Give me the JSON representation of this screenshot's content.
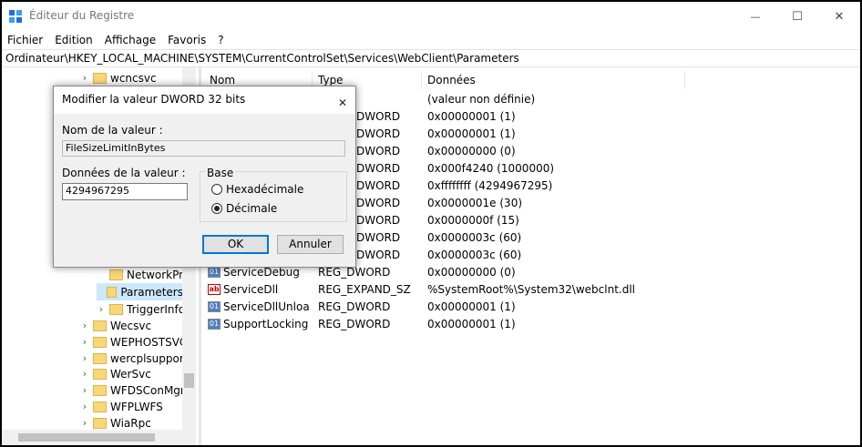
{
  "window": {
    "title": "Éditeur du Registre",
    "minimize_glyph": "—",
    "maximize_glyph": "☐",
    "close_glyph": "✕"
  },
  "menu": [
    "Fichier",
    "Edition",
    "Affichage",
    "Favoris",
    "?"
  ],
  "address": "Ordinateur\\HKEY_LOCAL_MACHINE\\SYSTEM\\CurrentControlSet\\Services\\WebClient\\Parameters",
  "tree": {
    "items": [
      {
        "label": "wcncsvc",
        "chevron": "›"
      },
      {
        "label": "NetworkPro",
        "chevron": ""
      },
      {
        "label": "Parameters",
        "chevron": "",
        "selected": true
      },
      {
        "label": "TriggerInfo",
        "chevron": "›"
      },
      {
        "label": "Wecsvc",
        "chevron": "›"
      },
      {
        "label": "WEPHOSTSVC",
        "chevron": "›"
      },
      {
        "label": "wercplsupport",
        "chevron": "›"
      },
      {
        "label": "WerSvc",
        "chevron": "›"
      },
      {
        "label": "WFDSConMgrS",
        "chevron": "›"
      },
      {
        "label": "WFPLWFS",
        "chevron": "›"
      },
      {
        "label": "WiaRpc",
        "chevron": "›"
      }
    ]
  },
  "list": {
    "headers": {
      "name": "Nom",
      "type": "Type",
      "data": "Données"
    },
    "rows": [
      {
        "name": "",
        "type": "",
        "data": "(valeur non définie)",
        "icon": "",
        "type_tail": ""
      },
      {
        "name": "",
        "type": "REG_DWORD",
        "type_tail": "DWORD",
        "data": "0x00000001 (1)",
        "icon": ""
      },
      {
        "name": "",
        "type": "REG_DWORD",
        "type_tail": "DWORD",
        "data": "0x00000001 (1)",
        "icon": ""
      },
      {
        "name": "",
        "type": "REG_DWORD",
        "type_tail": "DWORD",
        "data": "0x00000000 (0)",
        "icon": ""
      },
      {
        "name": "",
        "type": "REG_DWORD",
        "type_tail": "DWORD",
        "data": "0x000f4240 (1000000)",
        "icon": ""
      },
      {
        "name": "",
        "type": "REG_DWORD",
        "type_tail": "DWORD",
        "data": "0xffffffff (4294967295)",
        "icon": ""
      },
      {
        "name": "",
        "type": "REG_DWORD",
        "type_tail": "DWORD",
        "data": "0x0000001e (30)",
        "icon": ""
      },
      {
        "name": "",
        "type": "REG_DWORD",
        "type_tail": "DWORD",
        "data": "0x0000000f (15)",
        "icon": ""
      },
      {
        "name": "",
        "type": "REG_DWORD",
        "type_tail": "DWORD",
        "data": "0x0000003c (60)",
        "icon": ""
      },
      {
        "name": "",
        "type": "REG_DWORD",
        "type_tail": "DWORD",
        "data": "0x0000003c (60)",
        "icon": ""
      },
      {
        "name": "ServiceDebug",
        "type": "REG_DWORD",
        "data": "0x00000000 (0)",
        "icon": "dword"
      },
      {
        "name": "ServiceDll",
        "type": "REG_EXPAND_SZ",
        "data": "%SystemRoot%\\System32\\webclnt.dll",
        "icon": "ab"
      },
      {
        "name": "ServiceDllUnloa...",
        "type": "REG_DWORD",
        "data": "0x00000001 (1)",
        "icon": "dword"
      },
      {
        "name": "SupportLocking",
        "type": "REG_DWORD",
        "data": "0x00000001 (1)",
        "icon": "dword"
      }
    ]
  },
  "dialog": {
    "title": "Modifier la valeur DWORD 32 bits",
    "close_glyph": "✕",
    "name_label": "Nom de la valeur :",
    "name_value": "FileSizeLimitInBytes",
    "data_label": "Données de la valeur :",
    "data_value": "4294967295",
    "base_label": "Base",
    "hex_label": "Hexadécimale",
    "dec_label": "Décimale",
    "selected_base": "dec",
    "ok_label": "OK",
    "cancel_label": "Annuler"
  }
}
